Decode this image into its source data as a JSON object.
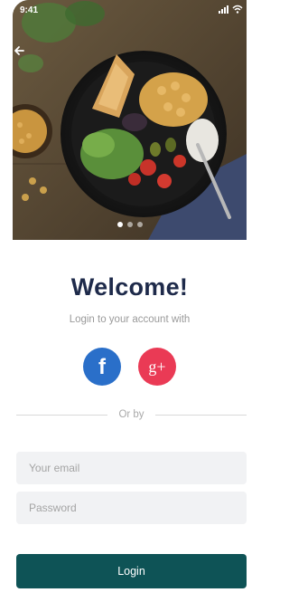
{
  "status_bar": {
    "time": "9:41"
  },
  "hero": {
    "carousel_pages": 3,
    "active_page": 1
  },
  "welcome": {
    "title": "Welcome!",
    "subtitle": "Login to your account with"
  },
  "social": {
    "facebook_glyph": "f",
    "google_plus_glyph": "g+",
    "facebook_color": "#2a6fc9",
    "google_plus_color": "#ea3a55"
  },
  "divider": {
    "label": "Or by"
  },
  "form": {
    "email_placeholder": "Your email",
    "password_placeholder": "Password",
    "login_label": "Login"
  },
  "colors": {
    "title": "#1e2a4a",
    "login_button": "#0e5356",
    "field_background": "#f1f2f4"
  },
  "icons": [
    "back-arrow-icon",
    "signal-icon",
    "wifi-icon",
    "facebook-icon",
    "google-plus-icon"
  ]
}
